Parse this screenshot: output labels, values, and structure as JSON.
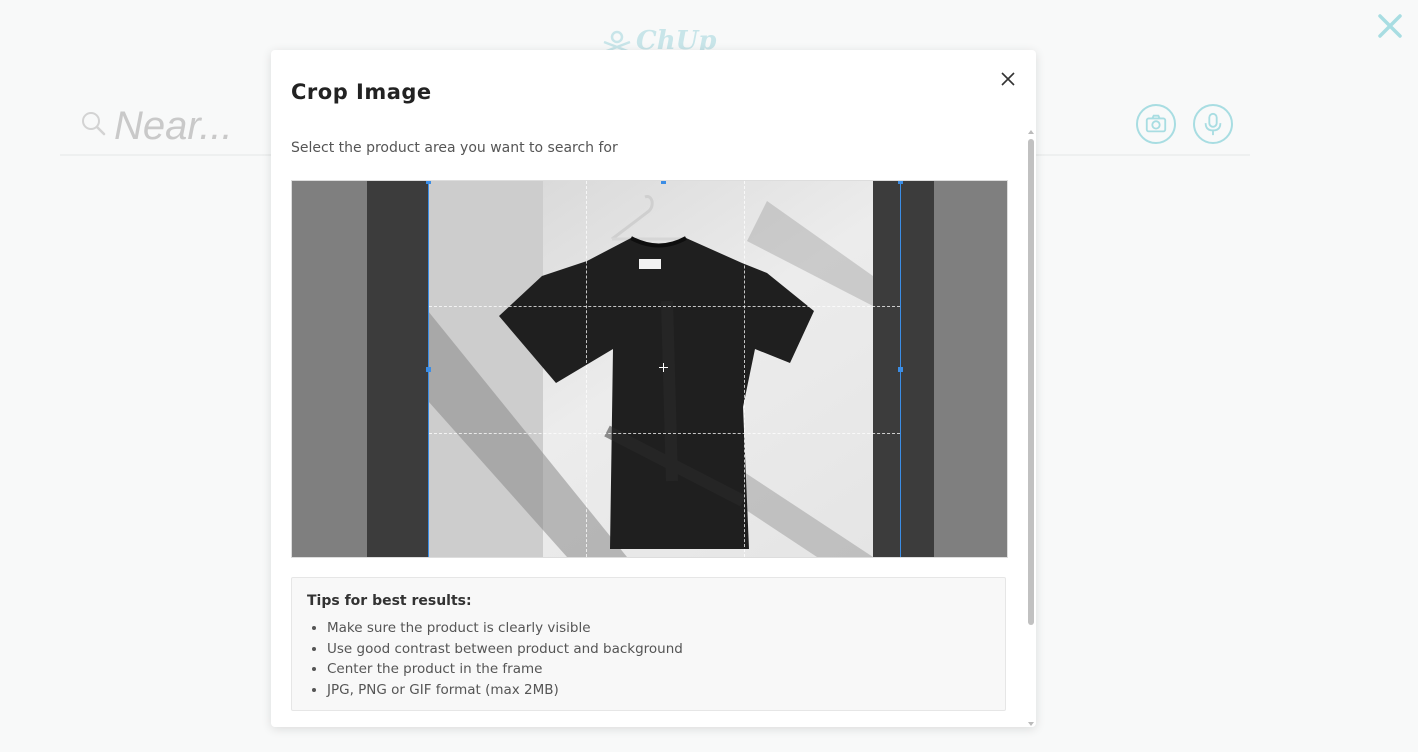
{
  "background": {
    "logo_text": "ChUp",
    "search": {
      "placeholder": "Near..."
    },
    "close_icon": "close-icon",
    "camera_icon": "camera-icon",
    "microphone_icon": "microphone-icon",
    "accent_color": "#8fcfd6"
  },
  "modal": {
    "title": "Crop Image",
    "subtitle": "Select the product area you want to search for",
    "close_icon": "close-icon",
    "image_subject": "black t-shirt on hanger",
    "tips": {
      "title": "Tips for best results:",
      "items": [
        "Make sure the product is clearly visible",
        "Use good contrast between product and background",
        "Center the product in the frame",
        "JPG, PNG or GIF format (max 2MB)"
      ]
    },
    "crop_accent_color": "#3b8de5"
  }
}
